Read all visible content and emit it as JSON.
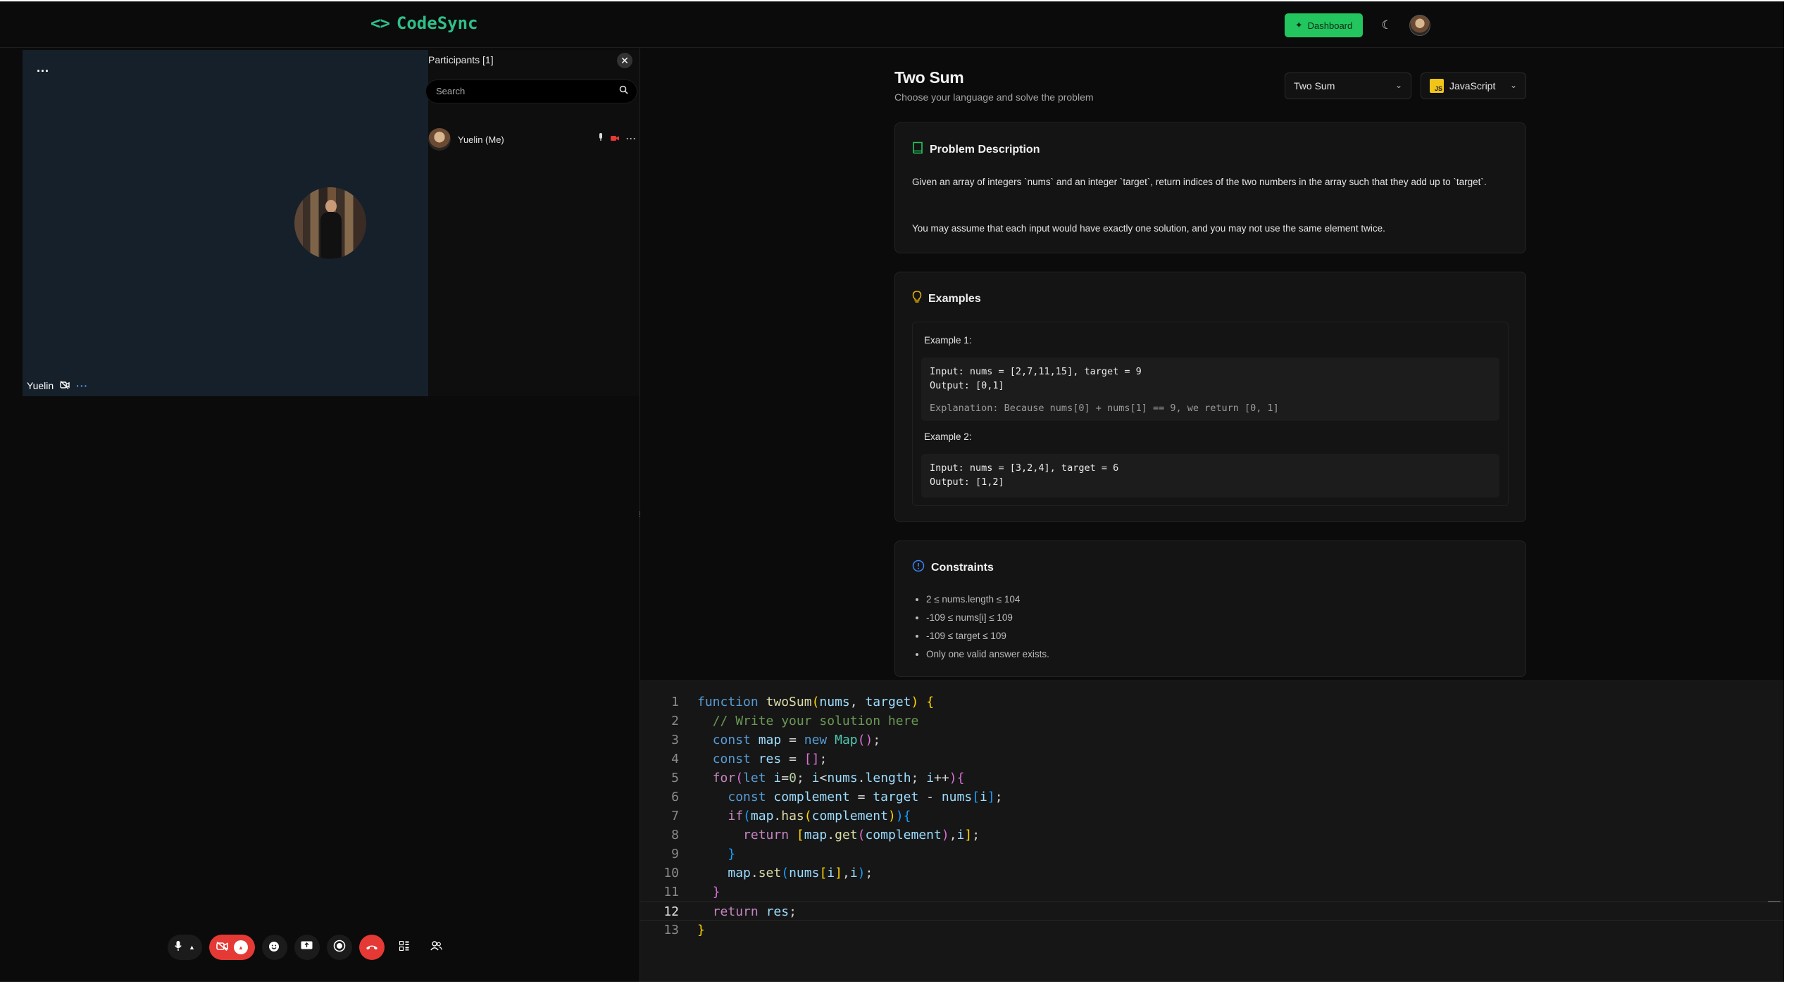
{
  "app": {
    "name": "CodeSync",
    "logo_icon": "<>"
  },
  "header": {
    "dashboard_label": "Dashboard",
    "theme_icon": "moon-icon"
  },
  "video": {
    "participant_name": "Yuelin",
    "menu": "...",
    "more": "···"
  },
  "participants": {
    "title": "Participants [1]",
    "search_placeholder": "Search",
    "list": [
      {
        "name": "Yuelin (Me)"
      }
    ]
  },
  "problem": {
    "title": "Two Sum",
    "subtitle": "Choose your language and solve the problem",
    "selected_problem": "Two Sum",
    "selected_language": "JavaScript",
    "language_badge": "JS",
    "description_title": "Problem Description",
    "description_p1": "Given an array of integers `nums` and an integer `target`, return indices of the two numbers in the array such that they add up to `target`.",
    "description_p2": "You may assume that each input would have exactly one solution, and you may not use the same element twice.",
    "examples_title": "Examples",
    "examples": [
      {
        "label": "Example 1:",
        "input": "Input: nums = [2,7,11,15], target = 9",
        "output": "Output: [0,1]",
        "explanation": "Explanation: Because nums[0] + nums[1] == 9, we return [0, 1]"
      },
      {
        "label": "Example 2:",
        "input": "Input: nums = [3,2,4], target = 6",
        "output": "Output: [1,2]"
      }
    ],
    "constraints_title": "Constraints",
    "constraints": [
      "2 ≤ nums.length ≤ 104",
      "-109 ≤ nums[i] ≤ 109",
      "-109 ≤ target ≤ 109",
      "Only one valid answer exists."
    ]
  },
  "editor": {
    "active_line": 12,
    "line_numbers": [
      "1",
      "2",
      "3",
      "4",
      "5",
      "6",
      "7",
      "8",
      "9",
      "10",
      "11",
      "12",
      "13"
    ]
  },
  "colors": {
    "accent": "#22c55e",
    "brand": "#2fbf8a",
    "danger": "#e53935",
    "background": "#0b0b0b"
  }
}
